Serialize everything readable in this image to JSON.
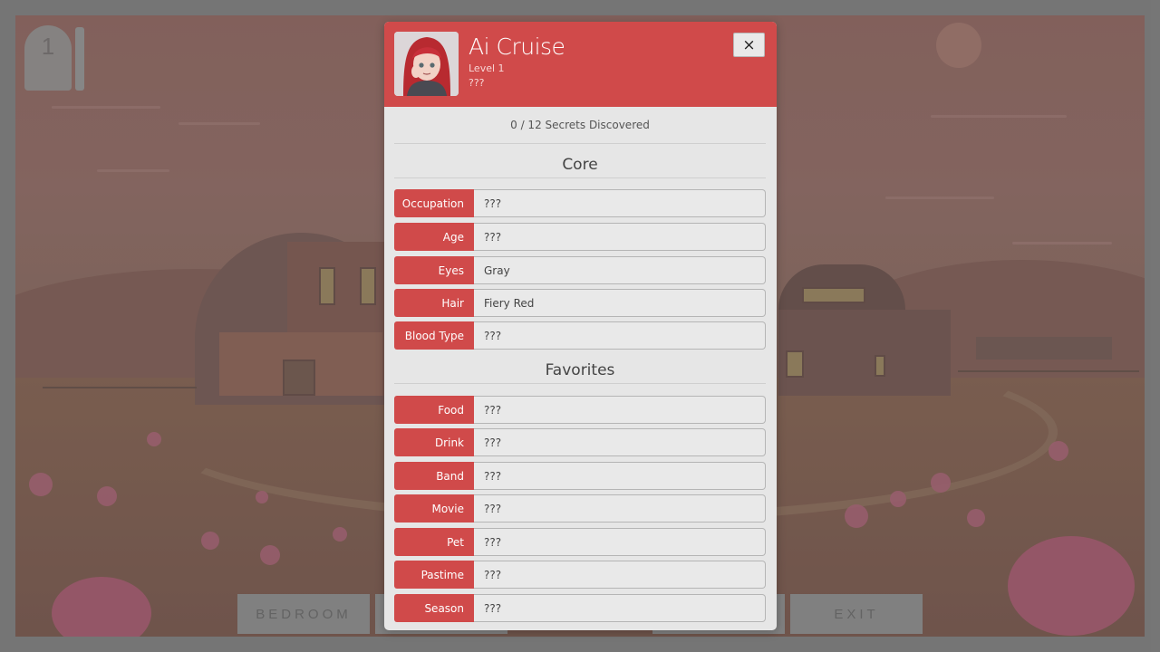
{
  "game": {
    "level_number": "1",
    "nav_buttons": [
      "BEDROOM",
      "EXIT"
    ]
  },
  "profile": {
    "name": "Ai Cruise",
    "level": "Level 1",
    "subtitle": "???",
    "close_label": "×",
    "secrets": "0 / 12 Secrets Discovered",
    "sections": [
      {
        "title": "Core",
        "rows": [
          {
            "label": "Occupation",
            "value": "???"
          },
          {
            "label": "Age",
            "value": "???"
          },
          {
            "label": "Eyes",
            "value": "Gray"
          },
          {
            "label": "Hair",
            "value": "Fiery Red"
          },
          {
            "label": "Blood Type",
            "value": "???"
          }
        ]
      },
      {
        "title": "Favorites",
        "rows": [
          {
            "label": "Food",
            "value": "???"
          },
          {
            "label": "Drink",
            "value": "???"
          },
          {
            "label": "Band",
            "value": "???"
          },
          {
            "label": "Movie",
            "value": "???"
          },
          {
            "label": "Pet",
            "value": "???"
          },
          {
            "label": "Pastime",
            "value": "???"
          },
          {
            "label": "Season",
            "value": "???"
          }
        ]
      }
    ]
  },
  "colors": {
    "accent": "#d04a4a",
    "panel": "#e6e6e6"
  }
}
